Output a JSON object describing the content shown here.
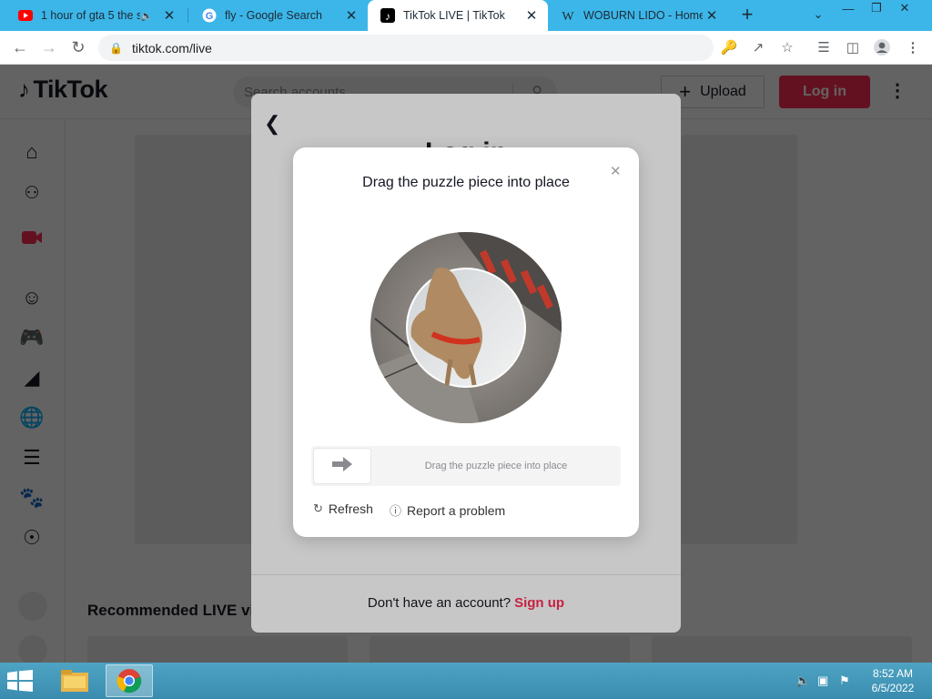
{
  "browser": {
    "tabs": [
      {
        "title": "1 hour of gta 5 the s",
        "favicon": "youtube-icon",
        "audio": true,
        "active": false
      },
      {
        "title": "fly - Google Search",
        "favicon": "google-icon",
        "active": false
      },
      {
        "title": "TikTok LIVE | TikTok",
        "favicon": "tiktok-icon",
        "active": true
      },
      {
        "title": "WOBURN LIDO - Home",
        "favicon": "woburn-icon",
        "active": false
      }
    ],
    "favicon_letters": {
      "google": "G",
      "woburn": "W"
    },
    "new_tab_symbol": "+",
    "url": "tiktok.com/live"
  },
  "tiktok": {
    "logo_text": "TikTok",
    "search_placeholder": "Search accounts",
    "upload_label": "Upload",
    "login_label": "Log in",
    "recommended_title": "Recommended LIVE vi",
    "brand_color": "#fe2c55"
  },
  "login_modal": {
    "title": "Log in",
    "footer_text": "Don't have an account?",
    "signup_label": "Sign up"
  },
  "captcha": {
    "title": "Drag the puzzle piece into place",
    "slider_hint": "Drag the puzzle piece into place",
    "refresh_label": "Refresh",
    "report_label": "Report a problem",
    "slider_progress": 0
  },
  "taskbar": {
    "apps": [
      "file-explorer",
      "google-chrome"
    ],
    "time": "8:52 AM",
    "date": "6/5/2022"
  }
}
